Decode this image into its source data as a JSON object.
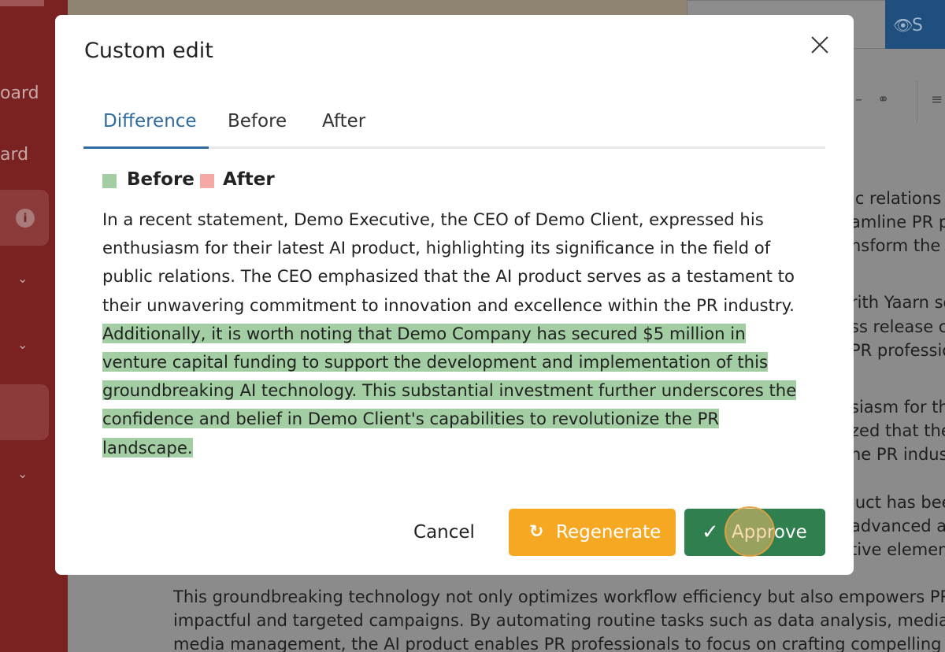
{
  "background": {
    "sidebar": {
      "items": [
        {
          "text": "oard"
        },
        {
          "text": "ard"
        }
      ],
      "info_glyph": "i"
    },
    "search_button_label": "S",
    "right_fragments": [
      "ic relations",
      "amline PR p",
      "nsform the v",
      "rith Yaarn so",
      "ss release c",
      "PR professio",
      "siasm for the",
      "zed that the",
      "he PR indus",
      "luct has bee",
      "advanced al",
      "tive element"
    ],
    "paragraph_lines": [
      "This groundbreaking technology not only optimizes workflow efficiency but also empowers PR te",
      "impactful and targeted campaigns. By automating routine tasks such as data analysis, media mon",
      "media management, the AI product enables PR professionals to focus on crafting compelling narr"
    ]
  },
  "modal": {
    "title": "Custom edit",
    "tabs": [
      {
        "label": "Difference",
        "active": true
      },
      {
        "label": "Before",
        "active": false
      },
      {
        "label": "After",
        "active": false
      }
    ],
    "legend": [
      {
        "label": "Before",
        "color": "#a3cea3"
      },
      {
        "label": "After",
        "color": "#f4a9a6"
      }
    ],
    "diff": {
      "unchanged": "In a recent statement, Demo Executive, the CEO of Demo Client, expressed his enthusiasm for their latest AI product, highlighting its significance in the field of public relations. The CEO emphasized that the AI product serves as a testament to their unwavering commitment to innovation and excellence within the PR industry.",
      "added": "Additionally, it is worth noting that Demo Company has secured $5 million in venture capital funding to support the development and implementation of this groundbreaking AI technology. This substantial investment further underscores the confidence and belief in Demo Client's capabilities to revolutionize the PR landscape."
    },
    "buttons": {
      "cancel": "Cancel",
      "regenerate": "Regenerate",
      "approve": "Approve"
    },
    "colors": {
      "accent": "#2f6b9e",
      "regenerate": "#f7a823",
      "approve": "#2f7f4f"
    }
  }
}
